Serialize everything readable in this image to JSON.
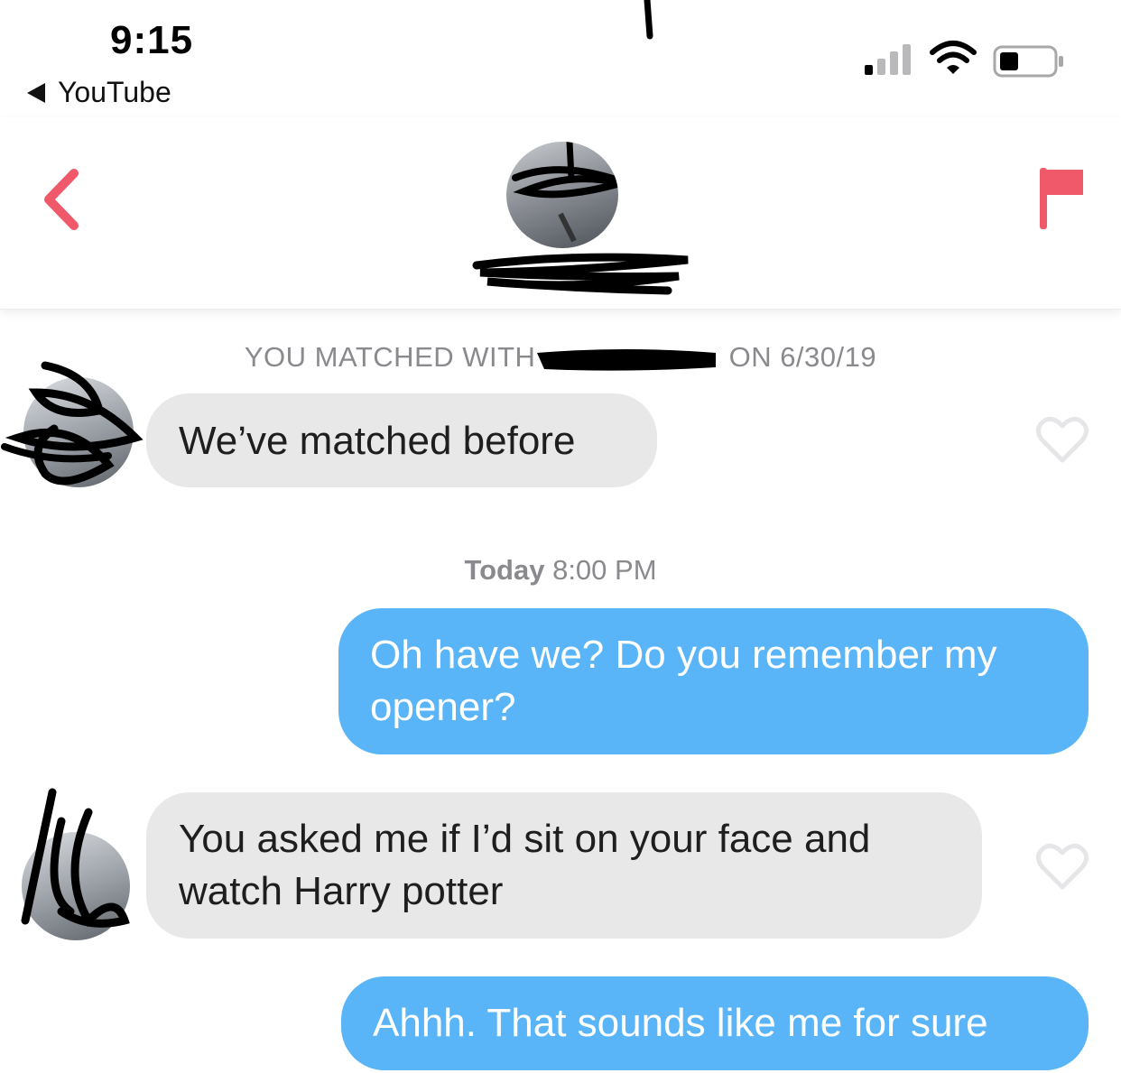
{
  "status_bar": {
    "time": "9:15",
    "back_app_label": "YouTube"
  },
  "header": {
    "back_icon": "chevron-left-icon",
    "report_icon": "flag-icon",
    "accent_color": "#f0596a"
  },
  "conversation": {
    "match_notice_prefix": "YOU MATCHED WITH",
    "match_notice_suffix": "ON 6/30/19",
    "timestamp_day": "Today",
    "timestamp_time": "8:00 PM",
    "messages": [
      {
        "side": "incoming",
        "text": "We’ve matched before"
      },
      {
        "side": "outgoing",
        "text": "Oh have we? Do you remember my opener?"
      },
      {
        "side": "incoming",
        "text": "You asked me if I’d sit on your face and watch Harry potter"
      },
      {
        "side": "outgoing",
        "text": "Ahhh. That sounds like me for sure"
      }
    ]
  },
  "colors": {
    "incoming_bubble": "#e8e8e9",
    "outgoing_bubble": "#5ab5f8",
    "meta_text": "#8a8a8e"
  }
}
